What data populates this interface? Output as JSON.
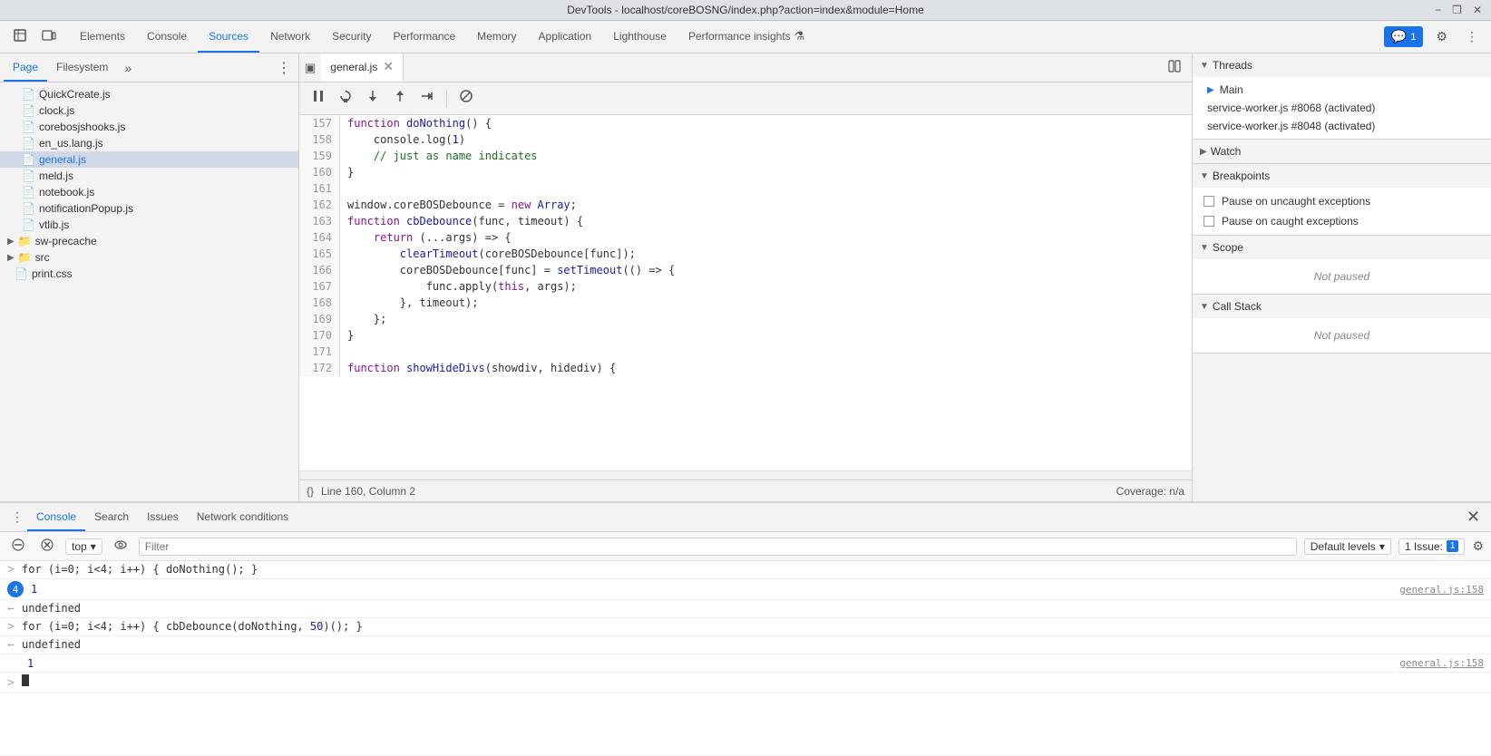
{
  "title_bar": {
    "title": "DevTools - localhost/coreBOSNG/index.php?action=index&module=Home",
    "minimize_label": "−",
    "restore_label": "❐",
    "close_label": "✕"
  },
  "top_nav": {
    "icons": {
      "inspect": "⊡",
      "device": "▭"
    },
    "tabs": [
      {
        "id": "elements",
        "label": "Elements",
        "active": false
      },
      {
        "id": "console",
        "label": "Console",
        "active": false
      },
      {
        "id": "sources",
        "label": "Sources",
        "active": true
      },
      {
        "id": "network",
        "label": "Network",
        "active": false
      },
      {
        "id": "security",
        "label": "Security",
        "active": false
      },
      {
        "id": "performance",
        "label": "Performance",
        "active": false
      },
      {
        "id": "memory",
        "label": "Memory",
        "active": false
      },
      {
        "id": "application",
        "label": "Application",
        "active": false
      },
      {
        "id": "lighthouse",
        "label": "Lighthouse",
        "active": false
      },
      {
        "id": "performance_insights",
        "label": "Performance insights",
        "active": false
      }
    ],
    "feedback_btn": "1",
    "settings_icon": "⚙",
    "more_icon": "⋮"
  },
  "sources_panel": {
    "tabs": [
      {
        "id": "page",
        "label": "Page",
        "active": true
      },
      {
        "id": "filesystem",
        "label": "Filesystem",
        "active": false
      }
    ],
    "more_icon": "»",
    "menu_icon": "⋮",
    "files": [
      {
        "id": "quickcreate",
        "name": "QuickCreate.js",
        "type": "file",
        "indent": 16
      },
      {
        "id": "clock",
        "name": "clock.js",
        "type": "file",
        "indent": 16
      },
      {
        "id": "corebosjshooks",
        "name": "corebosjshooks.js",
        "type": "file",
        "indent": 16
      },
      {
        "id": "en_us",
        "name": "en_us.lang.js",
        "type": "file",
        "indent": 16
      },
      {
        "id": "general",
        "name": "general.js",
        "type": "file",
        "indent": 16,
        "selected": true
      },
      {
        "id": "meld",
        "name": "meld.js",
        "type": "file",
        "indent": 16
      },
      {
        "id": "notebook",
        "name": "notebook.js",
        "type": "file",
        "indent": 16
      },
      {
        "id": "notificationpopup",
        "name": "notificationPopup.js",
        "type": "file",
        "indent": 16
      },
      {
        "id": "vtlib",
        "name": "vtlib.js",
        "type": "file",
        "indent": 16
      }
    ],
    "folders": [
      {
        "id": "sw-precache",
        "name": "sw-precache",
        "type": "folder",
        "indent": 8
      },
      {
        "id": "src",
        "name": "src",
        "type": "folder",
        "indent": 8
      }
    ],
    "extra_files": [
      {
        "id": "print-css",
        "name": "print.css",
        "type": "file-css",
        "indent": 8
      }
    ]
  },
  "editor": {
    "tab_label": "general.js",
    "icon_sidebar": "▣",
    "icon_split": "⊡",
    "icon_step_over": "↺",
    "icon_step_into": "↓",
    "icon_step_out": "↑",
    "icon_step_continue": "→|",
    "icon_deactivate": "⊗",
    "lines": [
      {
        "num": 157,
        "content": "function doNothing() {",
        "tokens": [
          {
            "type": "kw",
            "text": "function "
          },
          {
            "type": "fn",
            "text": "doNothing"
          },
          {
            "type": "punc",
            "text": "() {"
          }
        ]
      },
      {
        "num": 158,
        "content": "    console.log(1)",
        "tokens": [
          {
            "type": "var-name",
            "text": "    console.log("
          },
          {
            "type": "num",
            "text": "1"
          },
          {
            "type": "punc",
            "text": ")"
          }
        ]
      },
      {
        "num": 159,
        "content": "    // just as name indicates",
        "tokens": [
          {
            "type": "comment",
            "text": "    // just as name indicates"
          }
        ]
      },
      {
        "num": 160,
        "content": "}",
        "tokens": [
          {
            "type": "punc",
            "text": "}"
          }
        ]
      },
      {
        "num": 161,
        "content": "",
        "tokens": []
      },
      {
        "num": 162,
        "content": "window.coreBOSDebounce = new Array;",
        "tokens": [
          {
            "type": "var-name",
            "text": "window.coreBOSDebounce = "
          },
          {
            "type": "new-kw",
            "text": "new "
          },
          {
            "type": "fn",
            "text": "Array"
          },
          {
            "type": "punc",
            "text": ";"
          }
        ]
      },
      {
        "num": 163,
        "content": "function cbDebounce(func, timeout) {",
        "tokens": [
          {
            "type": "kw",
            "text": "function "
          },
          {
            "type": "fn",
            "text": "cbDebounce"
          },
          {
            "type": "punc",
            "text": "(func, timeout) {"
          }
        ]
      },
      {
        "num": 164,
        "content": "    return (...args) => {",
        "tokens": [
          {
            "type": "kw",
            "text": "    return "
          },
          {
            "type": "punc",
            "text": "(...args) => {"
          }
        ]
      },
      {
        "num": 165,
        "content": "        clearTimeout(coreBOSDebounce[func]);",
        "tokens": [
          {
            "type": "fn",
            "text": "        clearTimeout"
          },
          {
            "type": "punc",
            "text": "(coreBOSDebounce[func]);"
          }
        ]
      },
      {
        "num": 166,
        "content": "        coreBOSDebounce[func] = setTimeout(() => {",
        "tokens": [
          {
            "type": "var-name",
            "text": "        coreBOSDebounce[func] = "
          },
          {
            "type": "fn",
            "text": "setTimeout"
          },
          {
            "type": "punc",
            "text": "(() => {"
          }
        ]
      },
      {
        "num": 167,
        "content": "            func.apply(this, args);",
        "tokens": [
          {
            "type": "var-name",
            "text": "            func.apply("
          },
          {
            "type": "this-kw",
            "text": "this"
          },
          {
            "type": "punc",
            "text": ", args);"
          }
        ]
      },
      {
        "num": 168,
        "content": "        }, timeout);",
        "tokens": [
          {
            "type": "punc",
            "text": "        }, timeout);"
          }
        ]
      },
      {
        "num": 169,
        "content": "    };",
        "tokens": [
          {
            "type": "punc",
            "text": "    };"
          }
        ]
      },
      {
        "num": 170,
        "content": "}",
        "tokens": [
          {
            "type": "punc",
            "text": "}"
          }
        ]
      },
      {
        "num": 171,
        "content": "",
        "tokens": []
      },
      {
        "num": 172,
        "content": "function showHideDivs(showdiv, hidediv) {",
        "tokens": [
          {
            "type": "kw",
            "text": "function "
          },
          {
            "type": "fn",
            "text": "showHideDivs"
          },
          {
            "type": "punc",
            "text": "(showdiv, hidediv) {"
          }
        ]
      }
    ],
    "status_bar": {
      "format_icon": "{}",
      "position": "Line 160, Column 2",
      "coverage": "Coverage: n/a"
    }
  },
  "right_panel": {
    "debugger_icons": {
      "pause": "⏸",
      "step_over": "↺",
      "step_into": "↓",
      "step_out": "↑",
      "continue": "→",
      "deactivate": "⊗"
    },
    "threads": {
      "label": "Threads",
      "items": [
        {
          "id": "main",
          "label": "Main",
          "active": true
        },
        {
          "id": "sw1",
          "label": "service-worker.js #8068 (activated)",
          "active": false
        },
        {
          "id": "sw2",
          "label": "service-worker.js #8048 (activated)",
          "active": false
        }
      ]
    },
    "watch": {
      "label": "Watch"
    },
    "breakpoints": {
      "label": "Breakpoints",
      "items": [
        {
          "id": "bp1",
          "label": "Pause on uncaught exceptions",
          "checked": false
        },
        {
          "id": "bp2",
          "label": "Pause on caught exceptions",
          "checked": false
        }
      ]
    },
    "scope": {
      "label": "Scope",
      "status": "Not paused"
    },
    "call_stack": {
      "label": "Call Stack",
      "status": "Not paused"
    }
  },
  "console_panel": {
    "tabs": [
      {
        "id": "console",
        "label": "Console",
        "active": true
      },
      {
        "id": "search",
        "label": "Search",
        "active": false
      },
      {
        "id": "issues",
        "label": "Issues",
        "active": false
      },
      {
        "id": "network_conditions",
        "label": "Network conditions",
        "active": false
      }
    ],
    "toolbar": {
      "clear_icon": "🚫",
      "context_label": "top",
      "context_arrow": "▾",
      "eye_icon": "👁",
      "filter_placeholder": "Filter",
      "default_levels": "Default levels",
      "levels_arrow": "▾",
      "issue_count": "1 Issue:",
      "issue_badge": "1",
      "settings_icon": "⚙"
    },
    "entries": [
      {
        "type": "input",
        "prompt": ">",
        "text": "for (i=0; i<4; i++) { doNothing(); }"
      },
      {
        "type": "output-num",
        "prompt": "",
        "badge": "4",
        "text": "1",
        "link": "general.js:158"
      },
      {
        "type": "result",
        "prompt": "←",
        "text": "undefined"
      },
      {
        "type": "input",
        "prompt": ">",
        "text": "for (i=0; i<4; i++) { cbDebounce(doNothing, 50)(); }"
      },
      {
        "type": "result",
        "prompt": "←",
        "text": "undefined"
      },
      {
        "type": "output-plain",
        "prompt": "",
        "text": "1",
        "link": "general.js:158"
      },
      {
        "type": "cursor",
        "prompt": ">",
        "text": ""
      }
    ]
  }
}
